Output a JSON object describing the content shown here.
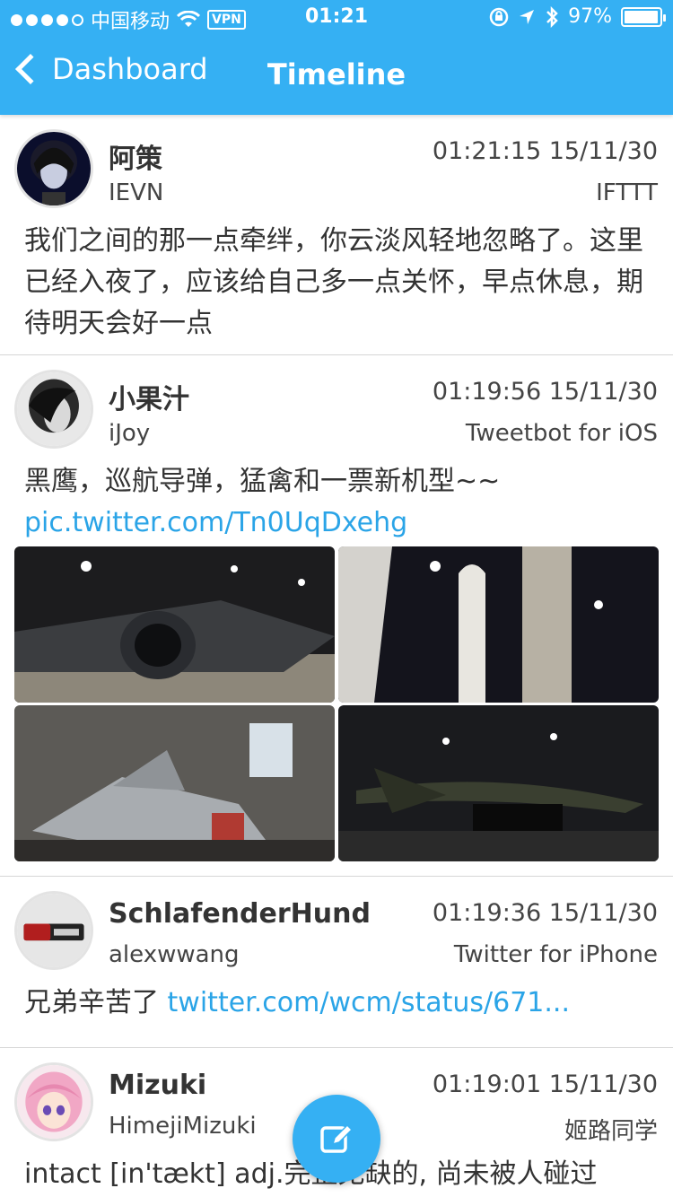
{
  "status_bar": {
    "carrier": "中国移动",
    "vpn": "VPN",
    "time": "01:21",
    "battery": "97%",
    "battery_level": 0.97
  },
  "nav": {
    "back_label": "Dashboard",
    "title": "Timeline"
  },
  "tweets": [
    {
      "name": "阿策",
      "handle": "IEVN",
      "timestamp": "01:21:15 15/11/30",
      "source": "IFTTT",
      "text": "我们之间的那一点牵绊，你云淡风轻地忽略了。这里已经入夜了，应该给自己多一点关怀，早点休息，期待明天会好一点",
      "link": ""
    },
    {
      "name": "小果汁",
      "handle": "iJoy",
      "timestamp": "01:19:56 15/11/30",
      "source": "Tweetbot for iOS",
      "text": "黑鹰，巡航导弹，猛禽和一票新机型~~",
      "link": "pic.twitter.com/Tn0UqDxehg"
    },
    {
      "name": "SchlafenderHund",
      "handle": "alexwwang",
      "timestamp": "01:19:36 15/11/30",
      "source": "Twitter for iPhone",
      "text": "兄弟辛苦了",
      "link": "twitter.com/wcm/status/671..."
    },
    {
      "name": "Mizuki",
      "handle": "HimejiMizuki",
      "timestamp": "01:19:01 15/11/30",
      "source": "姬路同学",
      "text": "intact [in'tækt] adj.完整无缺的, 尚未被人碰过",
      "link": ""
    }
  ],
  "colors": {
    "accent": "#35b0f3",
    "link": "#2aa4e7"
  },
  "icons": {
    "compose": "compose-icon",
    "back": "chevron-left-icon"
  }
}
